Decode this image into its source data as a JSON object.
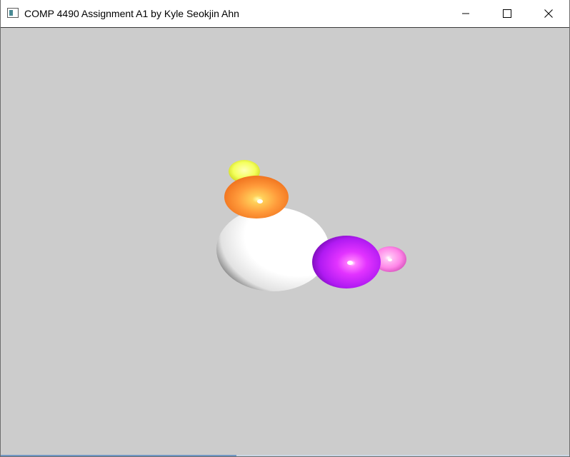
{
  "window": {
    "title": "COMP 4490 Assignment A1 by Kyle Seokjin Ahn",
    "app_icon": "app-window-icon",
    "controls": {
      "minimize_icon": "minimize-icon",
      "maximize_icon": "maximize-icon",
      "close_icon": "close-icon"
    }
  },
  "viewport": {
    "background_color": "#cccccc",
    "scene": {
      "objects": [
        {
          "name": "white-sphere",
          "color": "#ffffff"
        },
        {
          "name": "orange-sphere",
          "color": "#ff8a2a"
        },
        {
          "name": "yellow-sphere",
          "color": "#f2ff4a"
        },
        {
          "name": "purple-sphere",
          "color": "#b31aff"
        },
        {
          "name": "pink-sphere",
          "color": "#ff7ee6"
        }
      ]
    }
  }
}
